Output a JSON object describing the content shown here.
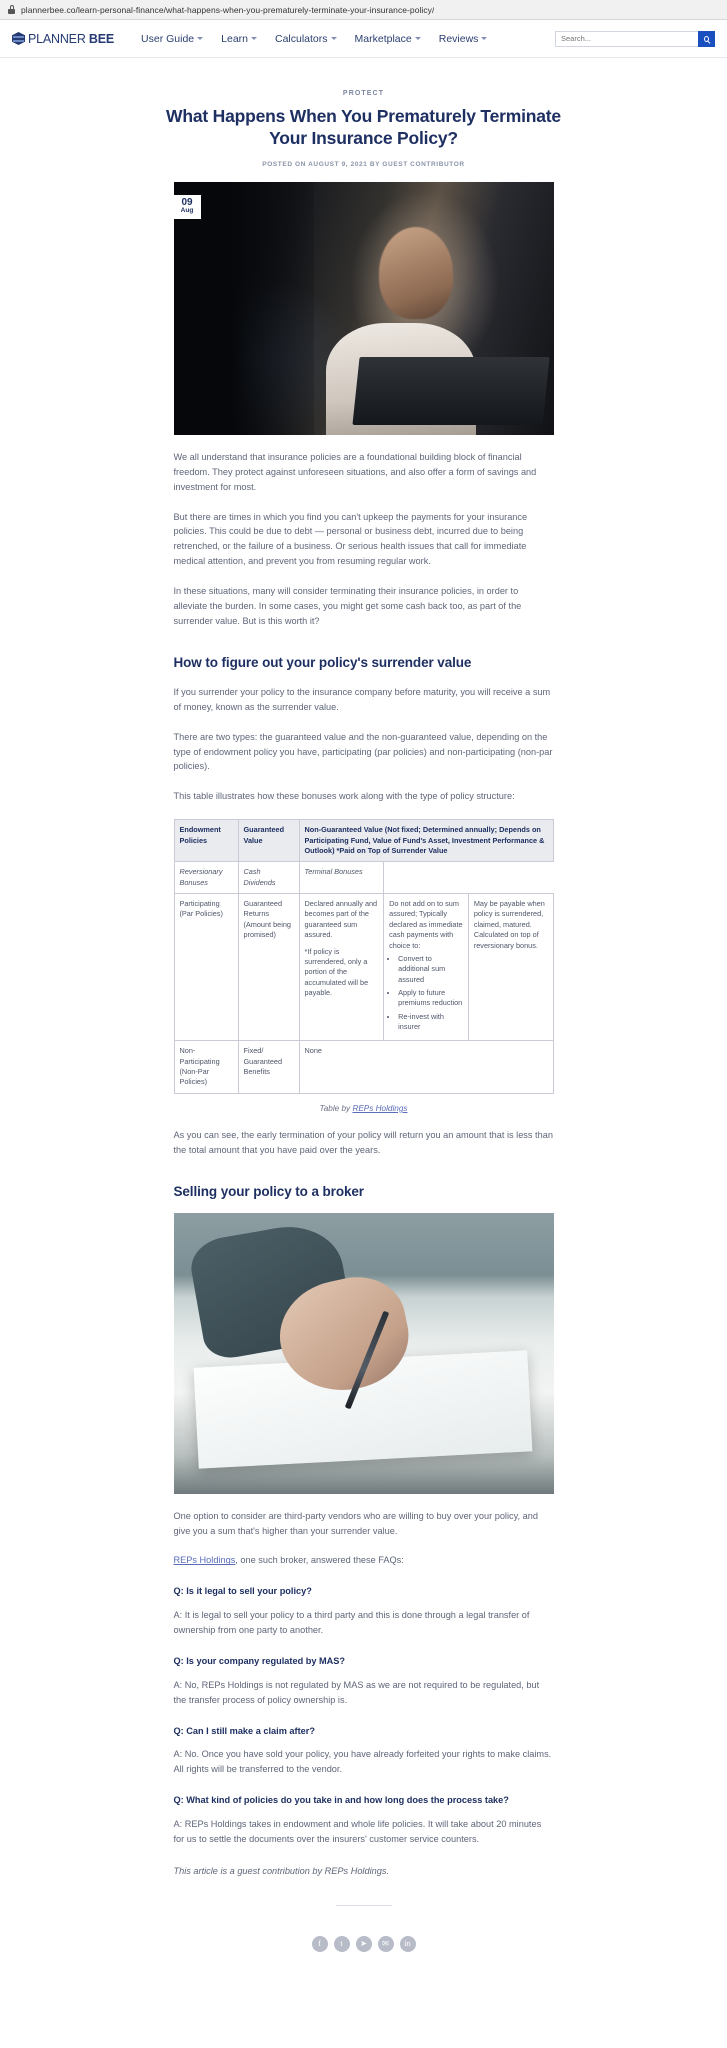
{
  "browser": {
    "url": "plannerbee.co/learn-personal-finance/what-happens-when-you-prematurely-terminate-your-insurance-policy/",
    "lock_icon": "lock-icon"
  },
  "header": {
    "brand_pre": "PLANNER ",
    "brand_bold": "BEE",
    "nav": [
      {
        "label": "User Guide",
        "has_caret": true
      },
      {
        "label": "Learn",
        "has_caret": true
      },
      {
        "label": "Calculators",
        "has_caret": true
      },
      {
        "label": "Marketplace",
        "has_caret": true
      },
      {
        "label": "Reviews",
        "has_caret": true
      }
    ],
    "search": {
      "placeholder": "Search...",
      "value": "",
      "button_icon": "search-icon"
    }
  },
  "article": {
    "category": "PROTECT",
    "title": "What Happens When You Prematurely Terminate Your Insurance Policy?",
    "byline": "POSTED ON AUGUST 9, 2021 BY GUEST CONTRIBUTOR",
    "date_badge": {
      "day": "09",
      "month": "Aug"
    },
    "hero_alt": "man-at-laptop-photo",
    "paragraphs": [
      "We all understand that insurance policies are a foundational building block of financial freedom. They protect against unforeseen situations, and also offer a form of savings and investment for most.",
      "But there are times in which you find you can't upkeep the payments for your insurance policies. This could be due to debt — personal or business debt, incurred due to being retrenched, or the failure of a business. Or serious health issues that call for immediate medical attention, and prevent you from resuming regular work.",
      "In these situations, many will consider terminating their insurance policies, in order to alleviate the burden. In some cases, you might get some cash back too, as part of the surrender value. But is this worth it?"
    ],
    "section1_heading": "How to figure out your policy's surrender value",
    "section1_paragraphs": [
      "If you surrender your policy to the insurance company before maturity, you will receive a sum of money, known as the surrender value.",
      "There are two types: the guaranteed value and the non-guaranteed value, depending on the type of endowment policy you have, participating (par policies) and non-participating (non-par policies).",
      "This table illustrates how these bonuses work along with the type of policy structure:"
    ],
    "after_table_paragraph": "As you can see, the early termination of your policy will return you an amount that is less than the total amount that you have paid over the years.",
    "section2_heading": "Selling your policy to a broker",
    "photo2_alt": "hand-signing-document-photo",
    "section2_paragraphs": [
      "One option to consider are third-party vendors who are willing to buy over your policy, and give you a sum that's higher than your surrender value."
    ],
    "broker_line_prefix": "",
    "broker_link": "REPs Holdings",
    "broker_line_suffix": ", one such broker, answered these FAQs:",
    "closing": "This article is a guest contribution by REPs Holdings."
  },
  "table": {
    "caption_prefix": "Table by ",
    "caption_link": "REPs Holdings",
    "headers": {
      "col1": "Endowment Policies",
      "col2": "Guaranteed Value",
      "col3": "Non-Guaranteed Value (Not fixed; Determined annually; Depends on Participating Fund, Value of Fund's Asset, Investment Performance & Outlook) *Paid on Top of Surrender Value"
    },
    "subheaders": {
      "col3": "Reversionary Bonuses",
      "col4": "Cash Dividends",
      "col5": "Terminal Bonuses"
    },
    "rows": [
      {
        "policy": "Participating (Par Policies)",
        "guaranteed": "Guaranteed Returns (Amount being promised)",
        "reversionary": "Declared annually and becomes part of the guaranteed sum assured.\n*If policy is surrendered, only a portion of the accumulated will be payable.",
        "reversionary_p1": "Declared annually and becomes part of the guaranteed sum assured.",
        "reversionary_p2": "*If policy is surrendered, only a portion of the accumulated will be payable.",
        "cash_intro": "Do not add on to sum assured; Typically declared as immediate cash payments with choice to:",
        "cash_bullets": [
          "Convert to additional sum assured",
          "Apply to future premiums reduction",
          "Re-invest with insurer"
        ],
        "terminal": "May be payable when policy is surrendered, claimed, matured. Calculated on top of reversionary bonus."
      },
      {
        "policy": "Non-Participating (Non-Par Policies)",
        "guaranteed": "Fixed/ Guaranteed Benefits",
        "non_guaranteed": "None"
      }
    ]
  },
  "faq": [
    {
      "q": "Q: Is it legal to sell your policy?",
      "a": "A: It is legal to sell your policy to a third party and this is done through a legal transfer of ownership from one party to another."
    },
    {
      "q": "Q: Is your company regulated by MAS?",
      "a": "A: No, REPs Holdings is not regulated by MAS as we are not required to be regulated, but the transfer process of policy ownership is."
    },
    {
      "q": "Q: Can I still make a claim after?",
      "a": "A: No. Once you have sold your policy, you have already forfeited your rights to make claims. All rights will be transferred to the vendor."
    },
    {
      "q": "Q: What kind of policies do you take in and how long does the process take?",
      "a": "A: REPs Holdings takes in endowment and whole life policies. It will take about 20 minutes for us to settle the documents over the insurers' customer service counters."
    }
  ],
  "share": [
    {
      "icon": "facebook-icon",
      "glyph": "f"
    },
    {
      "icon": "twitter-icon",
      "glyph": "t"
    },
    {
      "icon": "telegram-icon",
      "glyph": "➤"
    },
    {
      "icon": "email-icon",
      "glyph": "✉"
    },
    {
      "icon": "linkedin-icon",
      "glyph": "in"
    }
  ],
  "colors": {
    "brand_navy": "#1e2f62",
    "accent_blue": "#1a4fbf",
    "body_text": "#5f6679",
    "link": "#5a6bb8",
    "table_header_bg": "#e9ebee"
  }
}
